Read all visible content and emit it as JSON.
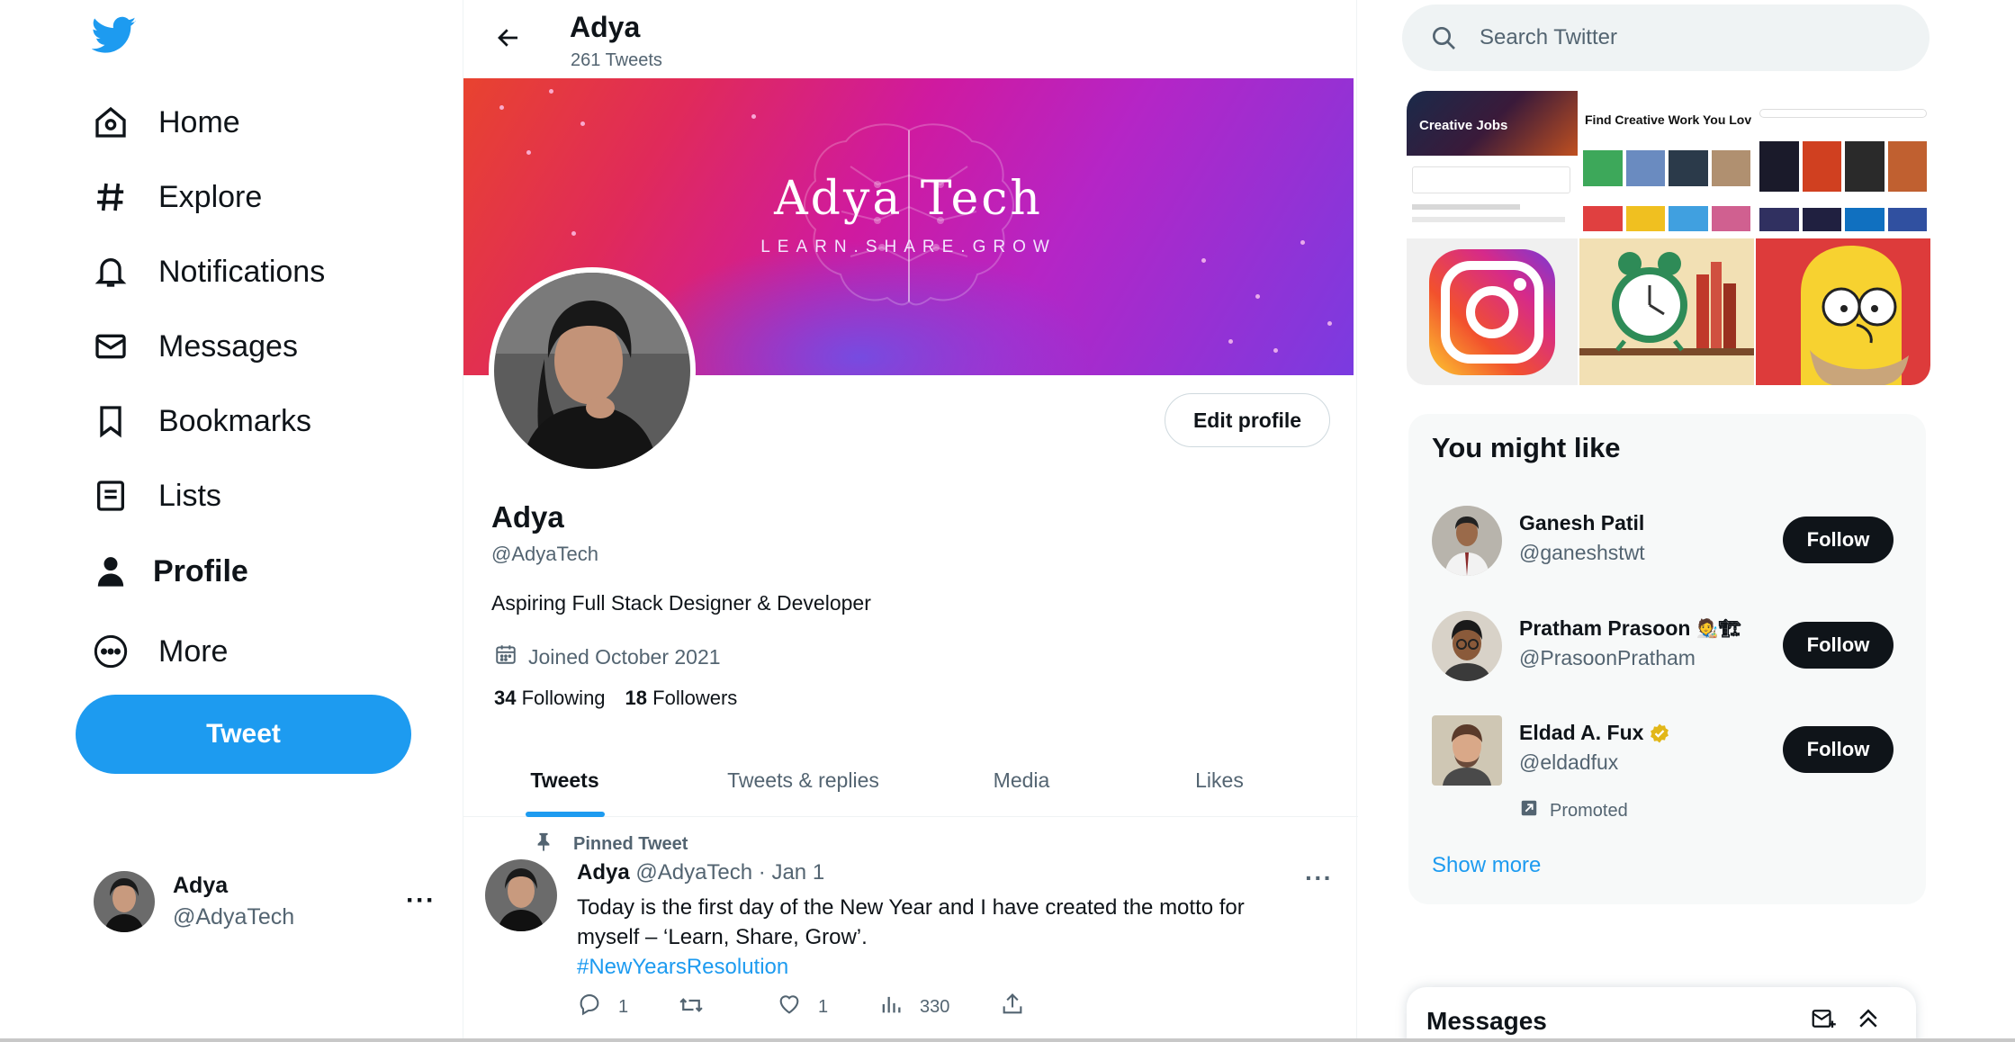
{
  "nav": {
    "items": [
      {
        "label": "Home",
        "icon": "home-icon"
      },
      {
        "label": "Explore",
        "icon": "hashtag-icon"
      },
      {
        "label": "Notifications",
        "icon": "bell-icon"
      },
      {
        "label": "Messages",
        "icon": "envelope-icon"
      },
      {
        "label": "Bookmarks",
        "icon": "bookmark-icon"
      },
      {
        "label": "Lists",
        "icon": "list-icon"
      },
      {
        "label": "Profile",
        "icon": "person-icon"
      },
      {
        "label": "More",
        "icon": "more-circle-icon"
      }
    ],
    "active": "Profile",
    "tweet_button": "Tweet",
    "account": {
      "name": "Adya",
      "handle": "@AdyaTech"
    }
  },
  "header": {
    "name": "Adya",
    "tweet_count": "261 Tweets"
  },
  "banner": {
    "title": "Adya Tech",
    "tagline": "LEARN.SHARE.GROW"
  },
  "profile": {
    "edit_button": "Edit profile",
    "name": "Adya",
    "handle": "@AdyaTech",
    "bio": "Aspiring Full Stack Designer & Developer",
    "joined": "Joined October 2021",
    "following_count": "34",
    "following_label": "Following",
    "followers_count": "18",
    "followers_label": "Followers"
  },
  "tabs": [
    "Tweets",
    "Tweets & replies",
    "Media",
    "Likes"
  ],
  "active_tab": "Tweets",
  "pinned_tweet": {
    "pinned_label": "Pinned Tweet",
    "name": "Adya",
    "handle": "@AdyaTech",
    "date": "· Jan 1",
    "text_line1": "Today is the first day of the New Year and I have created the motto for",
    "text_line2": "myself – ‘Learn, Share, Grow’.",
    "hashtag": "#NewYearsResolution",
    "replies": "1",
    "likes": "1",
    "views": "330"
  },
  "search": {
    "placeholder": "Search Twitter"
  },
  "media_tiles": {
    "jobs_heading": "Creative Jobs",
    "work_heading": "Find Creative Work You Lov"
  },
  "who_to_follow": {
    "title": "You might like",
    "users": [
      {
        "name": "Ganesh Patil",
        "handle": "@ganeshstwt",
        "button": "Follow"
      },
      {
        "name": "Pratham Prasoon",
        "emoji": "🧑‍🎨🏗",
        "handle": "@PrasoonPratham",
        "button": "Follow"
      },
      {
        "name": "Eldad A. Fux",
        "handle": "@eldadfux",
        "button": "Follow",
        "promoted": "Promoted"
      }
    ],
    "show_more": "Show more"
  },
  "messages_dock": {
    "title": "Messages"
  },
  "colors": {
    "accent": "#1d9bf0",
    "text": "#0f1419",
    "muted": "#536471"
  }
}
